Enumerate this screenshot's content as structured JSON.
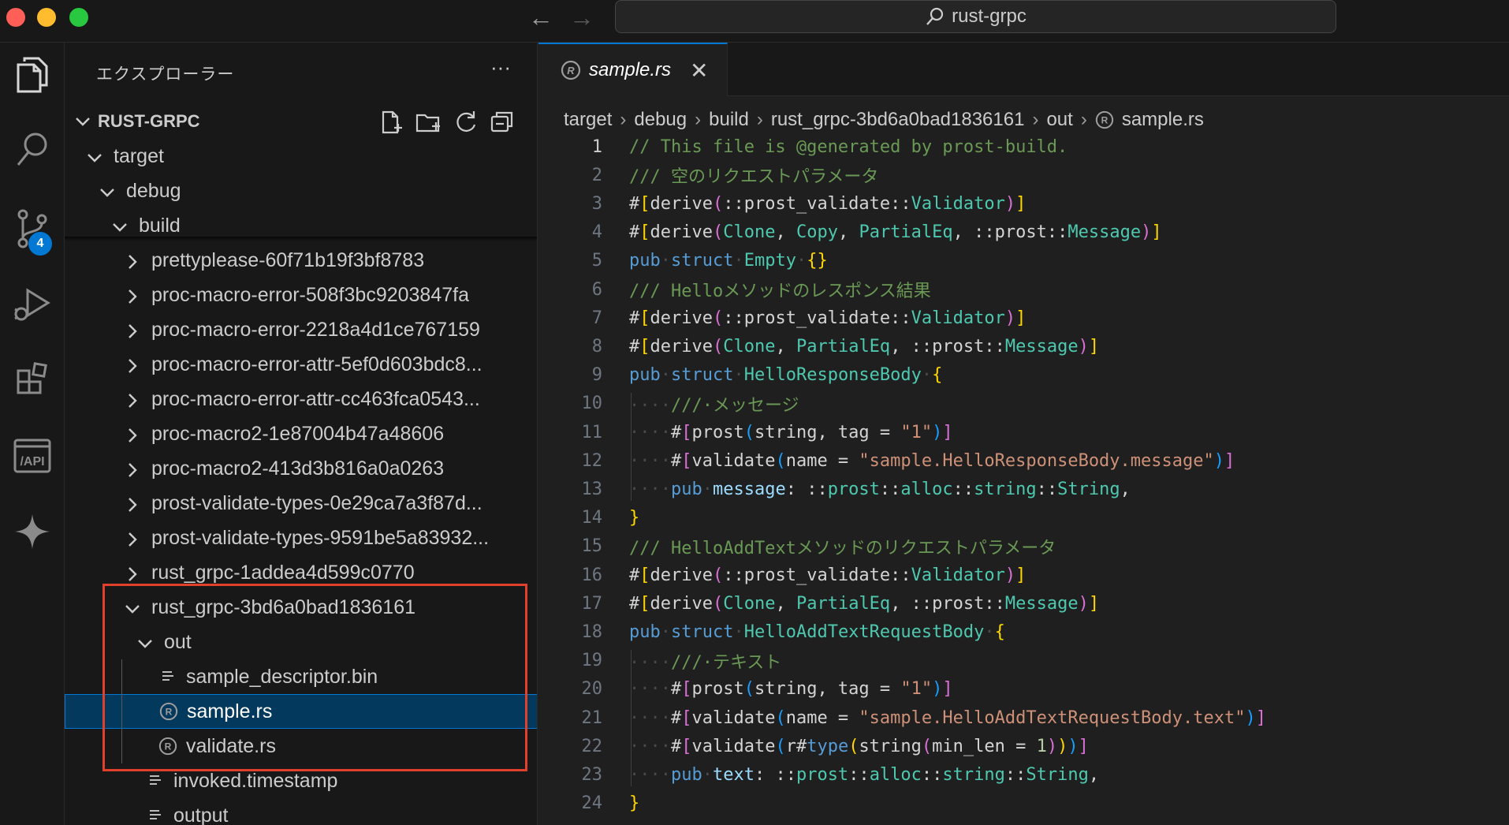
{
  "window": {
    "search_text": "rust-grpc",
    "traffic_colors": [
      "#ff5f57",
      "#febc2e",
      "#28c840"
    ]
  },
  "activity_bar": {
    "items": [
      {
        "name": "explorer",
        "icon": "files-icon"
      },
      {
        "name": "search",
        "icon": "search-icon"
      },
      {
        "name": "source-control",
        "icon": "source-control-icon",
        "badge": "4"
      },
      {
        "name": "run-debug",
        "icon": "run-debug-icon"
      },
      {
        "name": "extensions",
        "icon": "extensions-icon"
      },
      {
        "name": "api",
        "icon": "api-icon",
        "label": "/API"
      },
      {
        "name": "ai",
        "icon": "sparkle-icon"
      }
    ]
  },
  "sidebar": {
    "title": "エクスプローラー",
    "more": "···",
    "root_label": "RUST-GRPC",
    "tree": [
      {
        "label": "target",
        "type": "folder",
        "open": true,
        "depth": 1
      },
      {
        "label": "debug",
        "type": "folder",
        "open": true,
        "depth": 2
      },
      {
        "label": "build",
        "type": "folder",
        "open": true,
        "depth": 3
      },
      {
        "label": "prettyplease-60f71b19f3bf8783",
        "type": "folder",
        "open": false,
        "depth": 4
      },
      {
        "label": "proc-macro-error-508f3bc9203847fa",
        "type": "folder",
        "open": false,
        "depth": 4
      },
      {
        "label": "proc-macro-error-2218a4d1ce767159",
        "type": "folder",
        "open": false,
        "depth": 4
      },
      {
        "label": "proc-macro-error-attr-5ef0d603bdc8...",
        "type": "folder",
        "open": false,
        "depth": 4
      },
      {
        "label": "proc-macro-error-attr-cc463fca0543...",
        "type": "folder",
        "open": false,
        "depth": 4
      },
      {
        "label": "proc-macro2-1e87004b47a48606",
        "type": "folder",
        "open": false,
        "depth": 4
      },
      {
        "label": "proc-macro2-413d3b816a0a0263",
        "type": "folder",
        "open": false,
        "depth": 4
      },
      {
        "label": "prost-validate-types-0e29ca7a3f87d...",
        "type": "folder",
        "open": false,
        "depth": 4
      },
      {
        "label": "prost-validate-types-9591be5a83932...",
        "type": "folder",
        "open": false,
        "depth": 4
      },
      {
        "label": "rust_grpc-1addea4d599c0770",
        "type": "folder",
        "open": false,
        "depth": 4
      },
      {
        "label": "rust_grpc-3bd6a0bad1836161",
        "type": "folder",
        "open": true,
        "depth": 4
      },
      {
        "label": "out",
        "type": "folder",
        "open": true,
        "depth": 5
      },
      {
        "label": "sample_descriptor.bin",
        "type": "file",
        "icon": "lines-file-icon",
        "depth": 6
      },
      {
        "label": "sample.rs",
        "type": "file",
        "icon": "rust-file-icon",
        "depth": 6,
        "selected": true
      },
      {
        "label": "validate.rs",
        "type": "file",
        "icon": "rust-file-icon",
        "depth": 6
      },
      {
        "label": "invoked.timestamp",
        "type": "file",
        "icon": "lines-file-icon",
        "depth": 5
      },
      {
        "label": "output",
        "type": "file",
        "icon": "lines-file-icon",
        "depth": 5
      }
    ]
  },
  "editor": {
    "tab_label": "sample.rs",
    "tab_close": "✕",
    "breadcrumb": [
      "target",
      "debug",
      "build",
      "rust_grpc-3bd6a0bad1836161",
      "out",
      "sample.rs"
    ],
    "active_line": 1,
    "lines": [
      [
        [
          "comment",
          "// This file is @generated by prost-build."
        ]
      ],
      [
        [
          "comment",
          "/// 空のリクエストパラメータ"
        ]
      ],
      [
        [
          "plain",
          "#"
        ],
        [
          "brace1",
          "["
        ],
        [
          "plain",
          "derive"
        ],
        [
          "brace2",
          "("
        ],
        [
          "plain",
          "::prost_validate::"
        ],
        [
          "type",
          "Validator"
        ],
        [
          "brace2",
          ")"
        ],
        [
          "brace1",
          "]"
        ]
      ],
      [
        [
          "plain",
          "#"
        ],
        [
          "brace1",
          "["
        ],
        [
          "plain",
          "derive"
        ],
        [
          "brace2",
          "("
        ],
        [
          "type",
          "Clone"
        ],
        [
          "plain",
          ", "
        ],
        [
          "type",
          "Copy"
        ],
        [
          "plain",
          ", "
        ],
        [
          "type",
          "PartialEq"
        ],
        [
          "plain",
          ", ::prost::"
        ],
        [
          "type",
          "Message"
        ],
        [
          "brace2",
          ")"
        ],
        [
          "brace1",
          "]"
        ]
      ],
      [
        [
          "keyword",
          "pub"
        ],
        [
          "ws",
          "·"
        ],
        [
          "keyword",
          "struct"
        ],
        [
          "ws",
          "·"
        ],
        [
          "type",
          "Empty"
        ],
        [
          "ws",
          "·"
        ],
        [
          "brace1",
          "{}"
        ]
      ],
      [
        [
          "comment",
          "/// Helloメソッドのレスポンス結果"
        ]
      ],
      [
        [
          "plain",
          "#"
        ],
        [
          "brace1",
          "["
        ],
        [
          "plain",
          "derive"
        ],
        [
          "brace2",
          "("
        ],
        [
          "plain",
          "::prost_validate::"
        ],
        [
          "type",
          "Validator"
        ],
        [
          "brace2",
          ")"
        ],
        [
          "brace1",
          "]"
        ]
      ],
      [
        [
          "plain",
          "#"
        ],
        [
          "brace1",
          "["
        ],
        [
          "plain",
          "derive"
        ],
        [
          "brace2",
          "("
        ],
        [
          "type",
          "Clone"
        ],
        [
          "plain",
          ", "
        ],
        [
          "type",
          "PartialEq"
        ],
        [
          "plain",
          ", ::prost::"
        ],
        [
          "type",
          "Message"
        ],
        [
          "brace2",
          ")"
        ],
        [
          "brace1",
          "]"
        ]
      ],
      [
        [
          "keyword",
          "pub"
        ],
        [
          "ws",
          "·"
        ],
        [
          "keyword",
          "struct"
        ],
        [
          "ws",
          "·"
        ],
        [
          "type",
          "HelloResponseBody"
        ],
        [
          "ws",
          "·"
        ],
        [
          "brace1",
          "{"
        ]
      ],
      [
        [
          "ws",
          "····"
        ],
        [
          "comment",
          "///·メッセージ"
        ]
      ],
      [
        [
          "ws",
          "····"
        ],
        [
          "plain",
          "#"
        ],
        [
          "brace2",
          "["
        ],
        [
          "plain",
          "prost"
        ],
        [
          "brace3",
          "("
        ],
        [
          "plain",
          "string, tag = "
        ],
        [
          "string",
          "\"1\""
        ],
        [
          "brace3",
          ")"
        ],
        [
          "brace2",
          "]"
        ]
      ],
      [
        [
          "ws",
          "····"
        ],
        [
          "plain",
          "#"
        ],
        [
          "brace2",
          "["
        ],
        [
          "plain",
          "validate"
        ],
        [
          "brace3",
          "("
        ],
        [
          "plain",
          "name = "
        ],
        [
          "string",
          "\"sample.HelloResponseBody.message\""
        ],
        [
          "brace3",
          ")"
        ],
        [
          "brace2",
          "]"
        ]
      ],
      [
        [
          "ws",
          "····"
        ],
        [
          "keyword",
          "pub"
        ],
        [
          "ws",
          "·"
        ],
        [
          "var",
          "message"
        ],
        [
          "plain",
          ": ::"
        ],
        [
          "type",
          "prost"
        ],
        [
          "plain",
          "::"
        ],
        [
          "type",
          "alloc"
        ],
        [
          "plain",
          "::"
        ],
        [
          "type",
          "string"
        ],
        [
          "plain",
          "::"
        ],
        [
          "type",
          "String"
        ],
        [
          "plain",
          ","
        ]
      ],
      [
        [
          "brace1",
          "}"
        ]
      ],
      [
        [
          "comment",
          "/// HelloAddTextメソッドのリクエストパラメータ"
        ]
      ],
      [
        [
          "plain",
          "#"
        ],
        [
          "brace1",
          "["
        ],
        [
          "plain",
          "derive"
        ],
        [
          "brace2",
          "("
        ],
        [
          "plain",
          "::prost_validate::"
        ],
        [
          "type",
          "Validator"
        ],
        [
          "brace2",
          ")"
        ],
        [
          "brace1",
          "]"
        ]
      ],
      [
        [
          "plain",
          "#"
        ],
        [
          "brace1",
          "["
        ],
        [
          "plain",
          "derive"
        ],
        [
          "brace2",
          "("
        ],
        [
          "type",
          "Clone"
        ],
        [
          "plain",
          ", "
        ],
        [
          "type",
          "PartialEq"
        ],
        [
          "plain",
          ", ::prost::"
        ],
        [
          "type",
          "Message"
        ],
        [
          "brace2",
          ")"
        ],
        [
          "brace1",
          "]"
        ]
      ],
      [
        [
          "keyword",
          "pub"
        ],
        [
          "ws",
          "·"
        ],
        [
          "keyword",
          "struct"
        ],
        [
          "ws",
          "·"
        ],
        [
          "type",
          "HelloAddTextRequestBody"
        ],
        [
          "ws",
          "·"
        ],
        [
          "brace1",
          "{"
        ]
      ],
      [
        [
          "ws",
          "····"
        ],
        [
          "comment",
          "///·テキスト"
        ]
      ],
      [
        [
          "ws",
          "····"
        ],
        [
          "plain",
          "#"
        ],
        [
          "brace2",
          "["
        ],
        [
          "plain",
          "prost"
        ],
        [
          "brace3",
          "("
        ],
        [
          "plain",
          "string, tag = "
        ],
        [
          "string",
          "\"1\""
        ],
        [
          "brace3",
          ")"
        ],
        [
          "brace2",
          "]"
        ]
      ],
      [
        [
          "ws",
          "····"
        ],
        [
          "plain",
          "#"
        ],
        [
          "brace2",
          "["
        ],
        [
          "plain",
          "validate"
        ],
        [
          "brace3",
          "("
        ],
        [
          "plain",
          "name = "
        ],
        [
          "string",
          "\"sample.HelloAddTextRequestBody.text\""
        ],
        [
          "brace3",
          ")"
        ],
        [
          "brace2",
          "]"
        ]
      ],
      [
        [
          "ws",
          "····"
        ],
        [
          "plain",
          "#"
        ],
        [
          "brace2",
          "["
        ],
        [
          "plain",
          "validate"
        ],
        [
          "brace3",
          "("
        ],
        [
          "plain",
          "r#"
        ],
        [
          "keyword",
          "type"
        ],
        [
          "brace1",
          "("
        ],
        [
          "plain",
          "string"
        ],
        [
          "brace2",
          "("
        ],
        [
          "plain",
          "min_len = "
        ],
        [
          "number",
          "1"
        ],
        [
          "brace2",
          ")"
        ],
        [
          "brace1",
          ")"
        ],
        [
          "brace3",
          ")"
        ],
        [
          "brace2",
          "]"
        ]
      ],
      [
        [
          "ws",
          "····"
        ],
        [
          "keyword",
          "pub"
        ],
        [
          "ws",
          "·"
        ],
        [
          "var",
          "text"
        ],
        [
          "plain",
          ": ::"
        ],
        [
          "type",
          "prost"
        ],
        [
          "plain",
          "::"
        ],
        [
          "type",
          "alloc"
        ],
        [
          "plain",
          "::"
        ],
        [
          "type",
          "string"
        ],
        [
          "plain",
          "::"
        ],
        [
          "type",
          "String"
        ],
        [
          "plain",
          ","
        ]
      ],
      [
        [
          "brace1",
          "}"
        ]
      ]
    ]
  }
}
